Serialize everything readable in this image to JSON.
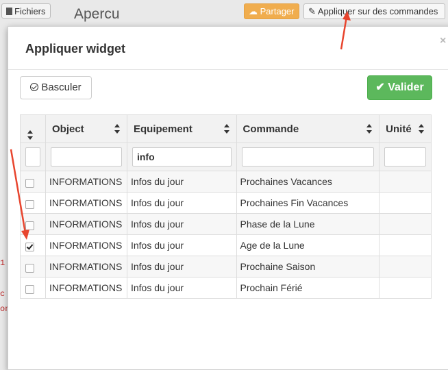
{
  "background": {
    "files_button": "Fichiers",
    "page_title": "Apercu",
    "share_button": "Partager",
    "apply_button": "Appliquer sur des commandes",
    "code_fragments": [
      "1",
      "c",
      "on"
    ]
  },
  "modal": {
    "title": "Appliquer widget",
    "close": "×",
    "toggle_button": "Basculer",
    "validate_button": "Valider",
    "columns": [
      "",
      "Object",
      "Equipement",
      "Commande",
      "Unité"
    ],
    "filters": {
      "object": "",
      "equipment": "info",
      "command": "",
      "unit": ""
    },
    "rows": [
      {
        "checked": false,
        "object": "INFORMATIONS",
        "equipment": "Infos du jour",
        "command": "Prochaines Vacances",
        "unit": ""
      },
      {
        "checked": false,
        "object": "INFORMATIONS",
        "equipment": "Infos du jour",
        "command": "Prochaines Fin Vacances",
        "unit": ""
      },
      {
        "checked": false,
        "object": "INFORMATIONS",
        "equipment": "Infos du jour",
        "command": "Phase de la Lune",
        "unit": ""
      },
      {
        "checked": true,
        "object": "INFORMATIONS",
        "equipment": "Infos du jour",
        "command": "Age de la Lune",
        "unit": ""
      },
      {
        "checked": false,
        "object": "INFORMATIONS",
        "equipment": "Infos du jour",
        "command": "Prochaine Saison",
        "unit": ""
      },
      {
        "checked": false,
        "object": "INFORMATIONS",
        "equipment": "Infos du jour",
        "command": "Prochain Férié",
        "unit": ""
      }
    ]
  },
  "colors": {
    "accent_orange": "#f0ad4e",
    "success_green": "#5cb85c",
    "annotation_red": "#e8452e"
  },
  "icons": {
    "files": "file-icon",
    "share": "cloud-upload-icon",
    "apply": "pencil-icon",
    "toggle": "circle-check-icon",
    "validate": "check-icon",
    "sort": "sort-icon"
  }
}
